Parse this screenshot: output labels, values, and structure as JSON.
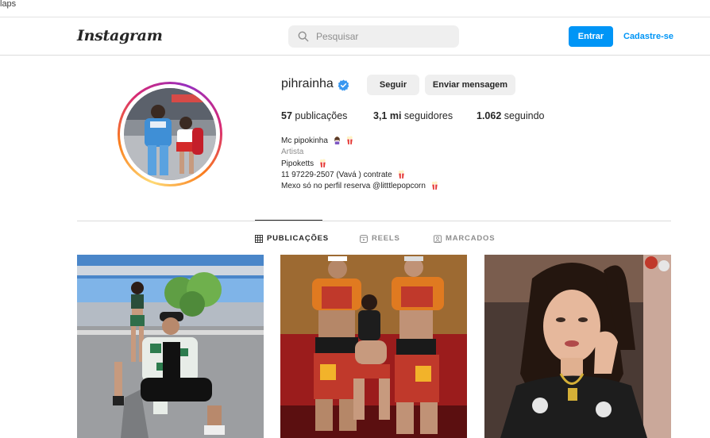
{
  "browser": {
    "bookmark_fragment": "laps"
  },
  "nav": {
    "logo": "Instagram",
    "search_placeholder": "Pesquisar",
    "login_label": "Entrar",
    "signup_label": "Cadastre-se"
  },
  "profile": {
    "username": "pihrainha",
    "follow_label": "Seguir",
    "message_label": "Enviar mensagem",
    "stats": {
      "posts_count": "57",
      "posts_label": "publicações",
      "followers_count": "3,1 mi",
      "followers_label": "seguidores",
      "following_count": "1.062",
      "following_label": "seguindo"
    },
    "bio": {
      "name": "Mc pipokinha",
      "category": "Artista",
      "line1": "Pipoketts",
      "line2": "11 97229-2507 (Vavá ) contrate",
      "line3": "Mexo só no perfil reserva @litttlepopcorn"
    }
  },
  "tabs": [
    {
      "label": "PUBLICAÇÕES",
      "icon": "grid-icon",
      "active": true
    },
    {
      "label": "REELS",
      "icon": "reels-icon",
      "active": false
    },
    {
      "label": "MARCADOS",
      "icon": "tagged-icon",
      "active": false
    }
  ],
  "colors": {
    "accent": "#0095f6",
    "verified": "#3897f0",
    "text": "#262626",
    "muted": "#8e8e8e"
  }
}
